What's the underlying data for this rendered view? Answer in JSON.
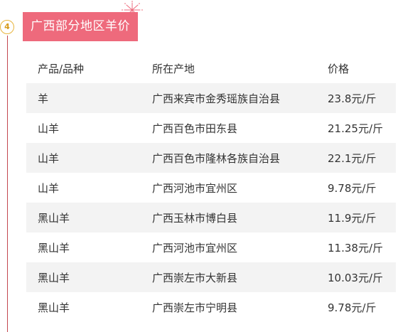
{
  "section": {
    "step_number": "4",
    "title": "广西部分地区羊价"
  },
  "table": {
    "headers": [
      "产品/品种",
      "所在产地",
      "价格"
    ],
    "rows": [
      {
        "product": "羊",
        "origin": "广西来宾市金秀瑶族自治县",
        "price": "23.8元/斤"
      },
      {
        "product": "山羊",
        "origin": "广西百色市田东县",
        "price": "21.25元/斤"
      },
      {
        "product": "山羊",
        "origin": "广西百色市隆林各族自治县",
        "price": "22.1元/斤"
      },
      {
        "product": "山羊",
        "origin": "广西河池市宜州区",
        "price": "9.78元/斤"
      },
      {
        "product": "黑山羊",
        "origin": "广西玉林市博白县",
        "price": "11.9元/斤"
      },
      {
        "product": "黑山羊",
        "origin": "广西河池市宜州区",
        "price": "11.38元/斤"
      },
      {
        "product": "黑山羊",
        "origin": "广西崇左市大新县",
        "price": "10.03元/斤"
      },
      {
        "product": "黑山羊",
        "origin": "广西崇左市宁明县",
        "price": "9.78元/斤"
      }
    ]
  },
  "colors": {
    "header_bg": "#ee6a7c",
    "timeline": "#c4474f",
    "badge_border": "#e8b43c",
    "row_shade": "#f3f3f3"
  }
}
